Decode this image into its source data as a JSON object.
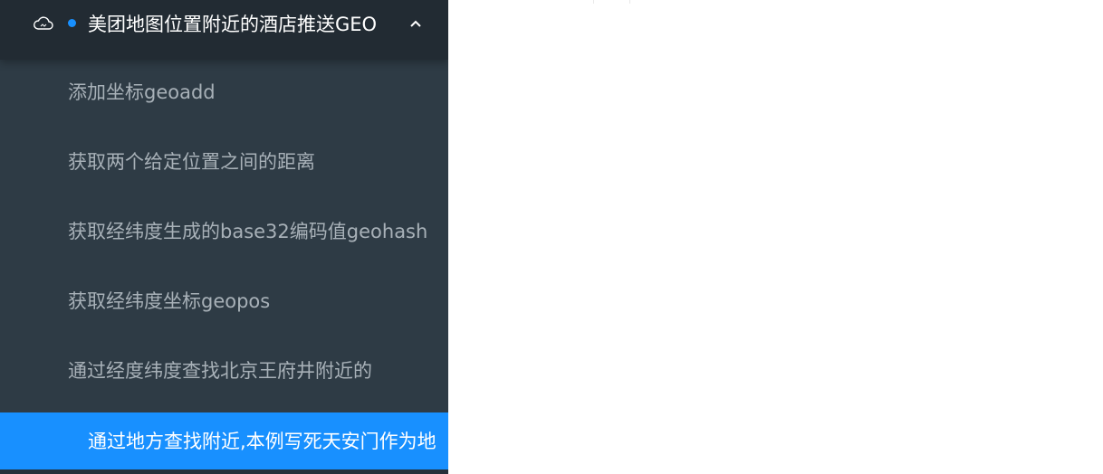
{
  "submenu": {
    "title": "美团地图位置附近的酒店推送GEO",
    "icon": "cloud-icon",
    "expand_icon": "chevron-up-icon",
    "accent": "#1890ff"
  },
  "items": [
    {
      "label": "添加坐标geoadd"
    },
    {
      "label": "获取两个给定位置之间的距离"
    },
    {
      "label": "获取经纬度生成的base32编码值geohash"
    },
    {
      "label": "获取经纬度坐标geopos"
    },
    {
      "label": "通过经度纬度查找北京王府井附近的"
    },
    {
      "label": "通过地方查找附近,本例写死天安门作为地"
    }
  ],
  "colors": {
    "sidebar_bg": "#2e3b45",
    "header_bg": "#222b33",
    "active_bg": "#1890ff",
    "item_text": "#a8b1b8",
    "active_text": "#ffffff"
  }
}
